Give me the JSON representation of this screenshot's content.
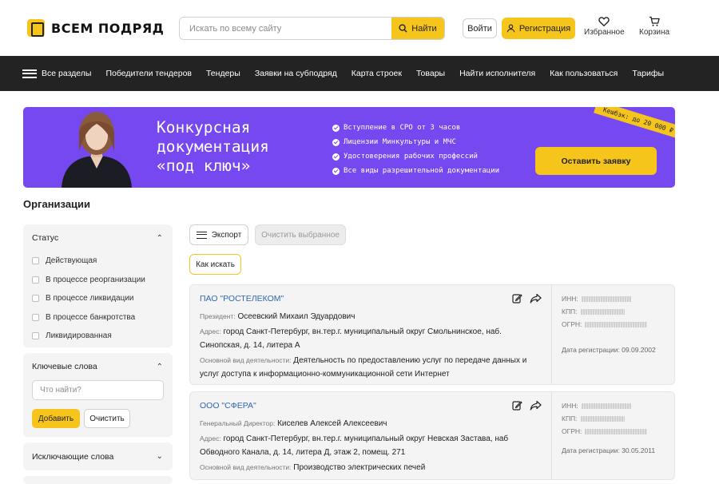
{
  "header": {
    "logo_text": "ВСЕМ ПОДРЯД",
    "search_placeholder": "Искать по всему сайту",
    "search_button": "Найти",
    "login_button": "Войти",
    "register_button": "Регистрация",
    "favorites_label": "Избранное",
    "cart_label": "Корзина"
  },
  "nav": {
    "items": [
      "Все разделы",
      "Победители тендеров",
      "Тендеры",
      "Заявки на субподряд",
      "Карта строек",
      "Товары",
      "Найти исполнителя",
      "Как пользоваться",
      "Тарифы"
    ]
  },
  "banner": {
    "title_lines": [
      "Конкурсная",
      "документация",
      "«под ключ»"
    ],
    "features": [
      "Вступление в СРО от 3 часов",
      "Лицензии Минкультуры и МЧС",
      "Удостоверения рабочих профессий",
      "Все виды разрешительной документации"
    ],
    "button": "Оставить заявку",
    "cashback": "Кешбэк: до 20 000 ₽"
  },
  "page": {
    "title": "Организации"
  },
  "filters": {
    "status": {
      "title": "Статус",
      "options": [
        "Действующая",
        "В процессе реорганизации",
        "В процессе ликвидации",
        "В процессе банкротства",
        "Ликвидированная"
      ]
    },
    "keywords": {
      "title": "Ключевые слова",
      "placeholder": "Что найти?",
      "add_button": "Добавить",
      "clear_button": "Очистить"
    },
    "exclude": {
      "title": "Исключающие слова"
    }
  },
  "toolbar": {
    "export_button": "Экспорт",
    "clear_selected_button": "Очистить выбранное",
    "howto_button": "Как искать"
  },
  "side_labels": {
    "inn": "ИНН:",
    "kpp": "КПП:",
    "ogrn": "ОГРН:"
  },
  "cards": [
    {
      "name": "ПАО \"РОСТЕЛЕКОМ\"",
      "head_label": "Президент:",
      "head_value": "Осеевский Михаил Эдуардович",
      "addr_label": "Адрес:",
      "addr_line1": "город Санкт-Петербург, вн.тер.г. муниципальный округ Смольнинское, наб.",
      "addr_line2": "Синопская, д. 14, литера А",
      "activity_label": "Основной вид деятельности:",
      "activity_line1": "Деятельность по предоставлению услуг по передаче данных и",
      "activity_line2": "услуг доступа к информационно-коммуникационной сети Интернет",
      "reg_date": "Дата регистрации: 09.09.2002"
    },
    {
      "name": "ООО \"СФЕРА\"",
      "head_label": "Генеральный Директор:",
      "head_value": "Киселев Алексей Алексеевич",
      "addr_label": "Адрес:",
      "addr_line1": "город Санкт-Петербург, вн.тер.г. муниципальный округ Невская Застава, наб",
      "addr_line2": "Обводного Канала, д. 14, литера Д, этаж 2, помещ. 271",
      "activity_label": "Основной вид деятельности:",
      "activity_line1": "Производство электрических печей",
      "reg_date": "Дата регистрации: 30.05.2011"
    }
  ]
}
